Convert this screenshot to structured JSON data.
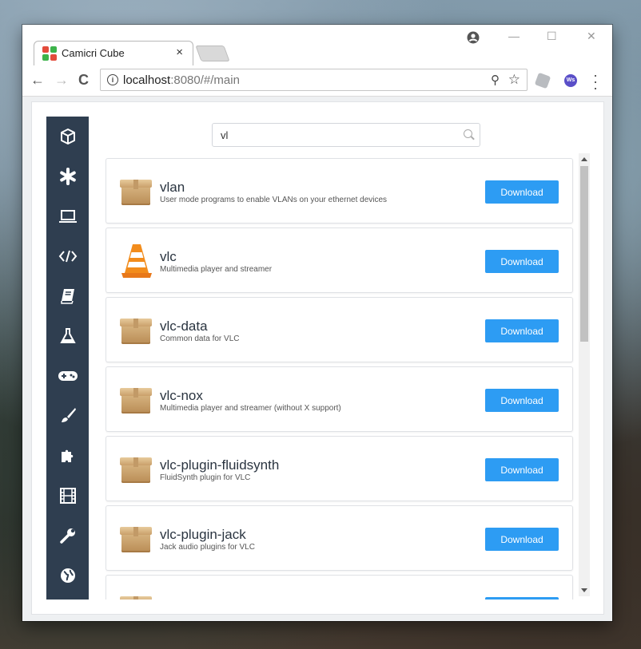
{
  "browser": {
    "tab_title": "Camicri Cube",
    "tab_close": "×",
    "url_host": "localhost",
    "url_path": ":8080/#/main",
    "nav": {
      "back": "←",
      "forward": "→",
      "reload": "C"
    },
    "window_controls": {
      "minimize": "—",
      "maximize": "☐",
      "close": "✕"
    },
    "ext_label": "Ws"
  },
  "search": {
    "value": "vl"
  },
  "sidebar": {
    "items": [
      {
        "icon": "cube-icon"
      },
      {
        "icon": "asterisk-icon"
      },
      {
        "icon": "laptop-icon"
      },
      {
        "icon": "code-icon"
      },
      {
        "icon": "book-icon"
      },
      {
        "icon": "flask-icon"
      },
      {
        "icon": "gamepad-icon"
      },
      {
        "icon": "paintbrush-icon"
      },
      {
        "icon": "puzzle-icon"
      },
      {
        "icon": "film-icon"
      },
      {
        "icon": "wrench-icon"
      },
      {
        "icon": "globe-icon"
      }
    ]
  },
  "packages": [
    {
      "name": "vlan",
      "description": "User mode programs to enable VLANs on your ethernet devices",
      "icon": "package-box-icon",
      "button": "Download"
    },
    {
      "name": "vlc",
      "description": "Multimedia player and streamer",
      "icon": "vlc-cone-icon",
      "button": "Download"
    },
    {
      "name": "vlc-data",
      "description": "Common data for VLC",
      "icon": "package-box-icon",
      "button": "Download"
    },
    {
      "name": "vlc-nox",
      "description": "Multimedia player and streamer (without X support)",
      "icon": "package-box-icon",
      "button": "Download"
    },
    {
      "name": "vlc-plugin-fluidsynth",
      "description": "FluidSynth plugin for VLC",
      "icon": "package-box-icon",
      "button": "Download"
    },
    {
      "name": "vlc-plugin-jack",
      "description": "Jack audio plugins for VLC",
      "icon": "package-box-icon",
      "button": "Download"
    }
  ],
  "colors": {
    "sidebar": "#2f3e50",
    "accent": "#2d9cf3"
  }
}
